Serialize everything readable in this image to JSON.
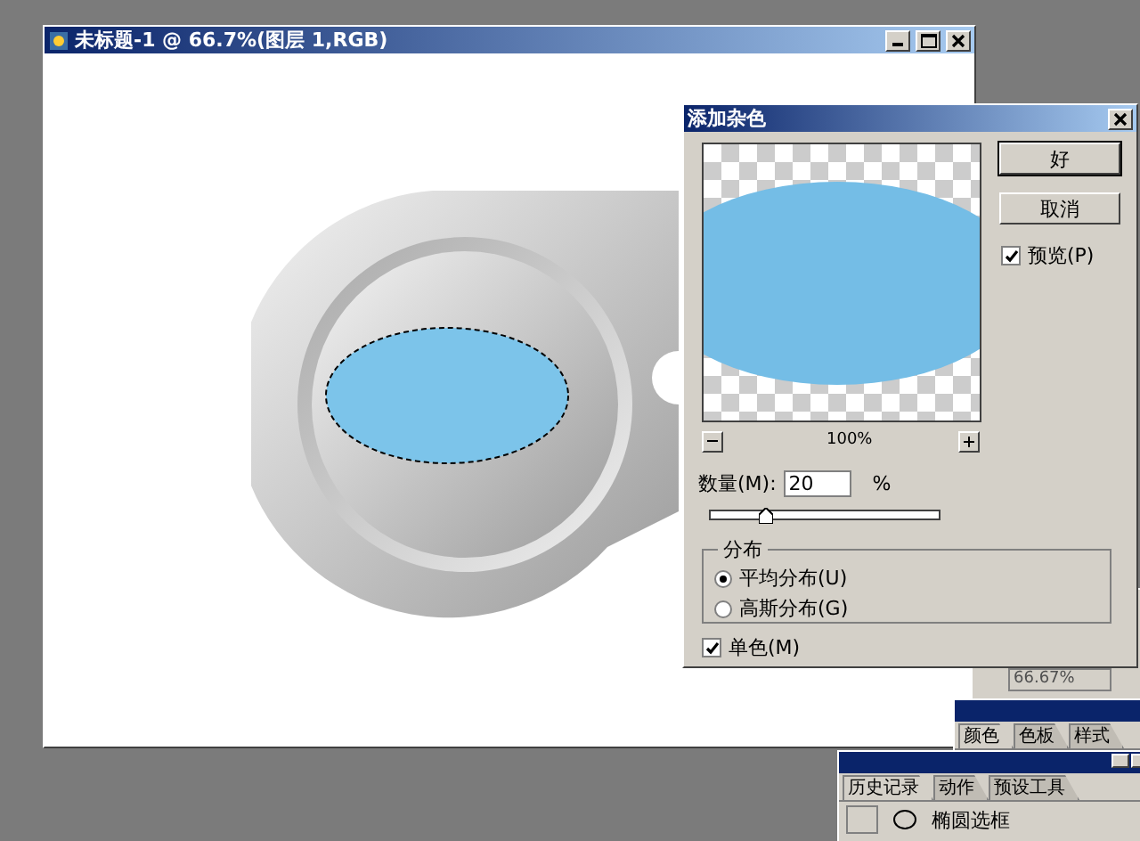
{
  "document": {
    "title": "未标题-1 @ 66.7%(图层 1,RGB)"
  },
  "dialog": {
    "title": "添加杂色",
    "buttons": [
      {
        "label": "好",
        "kind": "default"
      },
      {
        "label": "取消",
        "kind": "normal"
      }
    ],
    "preview": {
      "label": "预览(P)",
      "checked": true
    },
    "zoom": "100%",
    "amount": {
      "label": "数量(M):",
      "value": "20",
      "unit": "%",
      "level": 0.24
    },
    "distribution": {
      "title": "分布",
      "options": [
        {
          "label": "平均分布(U)",
          "selected": true
        },
        {
          "label": "高斯分布(G)",
          "selected": false
        }
      ]
    },
    "monochrome": {
      "label": "单色(M)",
      "checked": true
    }
  },
  "navigator": {
    "zoom": "66.67%"
  },
  "color_panel": {
    "tabs": [
      {
        "label": "颜色",
        "selected": true
      },
      {
        "label": "色板",
        "selected": false
      },
      {
        "label": "样式",
        "selected": false
      }
    ]
  },
  "history_panel": {
    "tabs": [
      {
        "label": "历史记录",
        "selected": true
      },
      {
        "label": "动作",
        "selected": false
      },
      {
        "label": "预设工具",
        "selected": false
      }
    ],
    "items": [
      {
        "label": "椭圆选框"
      }
    ]
  }
}
